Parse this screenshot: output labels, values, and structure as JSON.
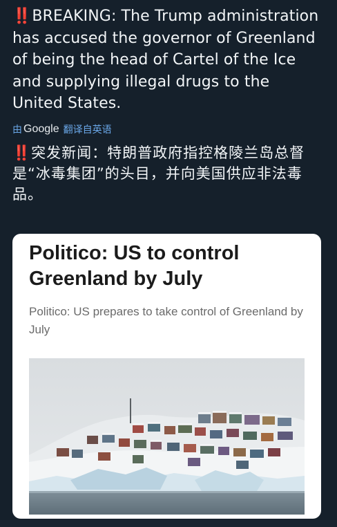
{
  "tweet": {
    "bang": "‼️",
    "english_text": "BREAKING: The Trump administration has accused the governor of Greenland of being the head of Cartel of the Ice and supplying illegal drugs to the United States.",
    "translation_by": "由",
    "translation_brand": "Google",
    "translation_label": "翻译自英语",
    "chinese_text": "突发新闻：特朗普政府指控格陵兰岛总督是“冰毒集团”的头目，并向美国供应非法毒品。"
  },
  "card": {
    "title": "Politico: US to control Greenland by July",
    "subtitle": "Politico: US prepares to take control of Greenland by July",
    "image": "snowy-greenland-village-photo"
  },
  "colors": {
    "background": "#15202b",
    "alert": "#e0245e",
    "link": "#6aa7e8"
  }
}
